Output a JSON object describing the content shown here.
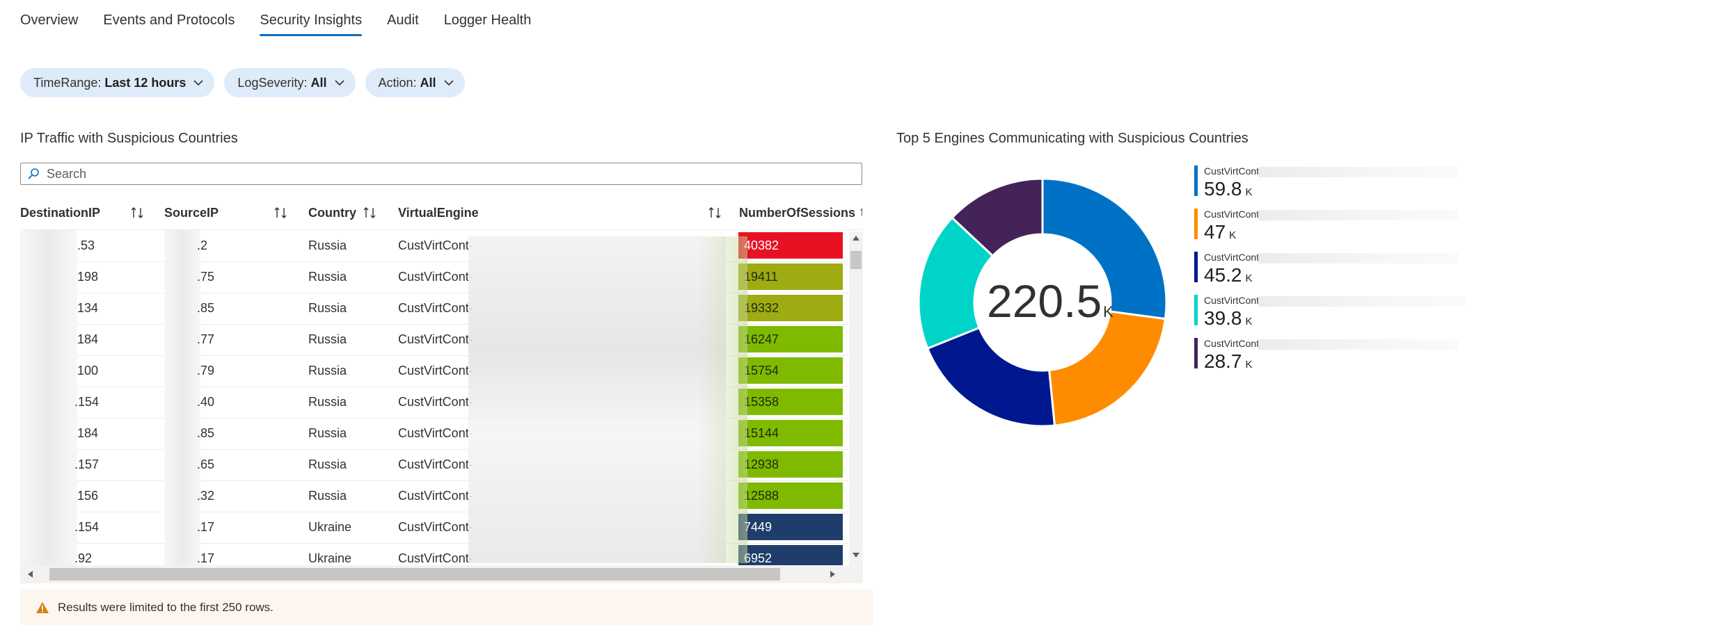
{
  "tabs": [
    {
      "label": "Overview"
    },
    {
      "label": "Events and Protocols"
    },
    {
      "label": "Security Insights"
    },
    {
      "label": "Audit"
    },
    {
      "label": "Logger Health"
    }
  ],
  "active_tab": "Security Insights",
  "filters": [
    {
      "key": "TimeRange:",
      "value": "Last 12 hours"
    },
    {
      "key": "LogSeverity:",
      "value": "All"
    },
    {
      "key": "Action:",
      "value": "All"
    }
  ],
  "table_section": {
    "title": "IP Traffic with Suspicious Countries",
    "search_placeholder": "Search",
    "columns": [
      "DestinationIP",
      "SourceIP",
      "Country",
      "VirtualEngine",
      "NumberOfSessions"
    ],
    "sort_indicator": "↑",
    "rows": [
      {
        "dest": ".53",
        "src": ".2",
        "country": "Russia",
        "ve": "CustVirtCont-",
        "sessions": "40382",
        "color": "#e81123"
      },
      {
        "dest": "198",
        "src": ".75",
        "country": "Russia",
        "ve": "CustVirtCont-",
        "sessions": "19411",
        "color": "#9eab12"
      },
      {
        "dest": "134",
        "src": ".85",
        "country": "Russia",
        "ve": "CustVirtCont-",
        "sessions": "19332",
        "color": "#9eab12"
      },
      {
        "dest": "184",
        "src": ".77",
        "country": "Russia",
        "ve": "CustVirtCont-",
        "sessions": "16247",
        "color": "#7fba00"
      },
      {
        "dest": "100",
        "src": ".79",
        "country": "Russia",
        "ve": "CustVirtCont-",
        "sessions": "15754",
        "color": "#7fba00"
      },
      {
        "dest": ".154",
        "src": ".40",
        "country": "Russia",
        "ve": "CustVirtCont-",
        "sessions": "15358",
        "color": "#7fba00"
      },
      {
        "dest": "184",
        "src": ".85",
        "country": "Russia",
        "ve": "CustVirtCont-",
        "sessions": "15144",
        "color": "#7fba00"
      },
      {
        "dest": ".157",
        "src": ".65",
        "country": "Russia",
        "ve": "CustVirtCont-",
        "sessions": "12938",
        "color": "#7fba00"
      },
      {
        "dest": "156",
        "src": ".32",
        "country": "Russia",
        "ve": "CustVirtCont-",
        "sessions": "12588",
        "color": "#7fba00"
      },
      {
        "dest": ".154",
        "src": ".17",
        "country": "Ukraine",
        "ve": "CustVirtCont-",
        "sessions": "7449",
        "color": "#1f3d6b"
      },
      {
        "dest": ".92",
        "src": ".17",
        "country": "Ukraine",
        "ve": "CustVirtCont-",
        "sessions": "6952",
        "color": "#1f3d6b"
      }
    ],
    "warning": "Results were limited to the first 250 rows."
  },
  "chart_section": {
    "title": "Top 5 Engines Communicating with Suspicious Countries",
    "center_value": "220.5",
    "center_unit": "K"
  },
  "chart_data": {
    "type": "pie",
    "title": "Top 5 Engines Communicating with Suspicious Countries",
    "total": "220.5K",
    "categories": [
      "CustVirtCont-",
      "CustVirtCont-",
      "CustVirtCont-",
      "CustVirtCont-",
      "CustVirtCont-"
    ],
    "values": [
      59.8,
      47,
      45.2,
      39.8,
      28.7
    ],
    "value_labels": [
      "59.8",
      "47",
      "45.2",
      "39.8",
      "28.7"
    ],
    "unit": "K",
    "colors": [
      "#0072c6",
      "#ff8c00",
      "#00188f",
      "#00d4c8",
      "#442359"
    ],
    "legend_position": "right"
  }
}
